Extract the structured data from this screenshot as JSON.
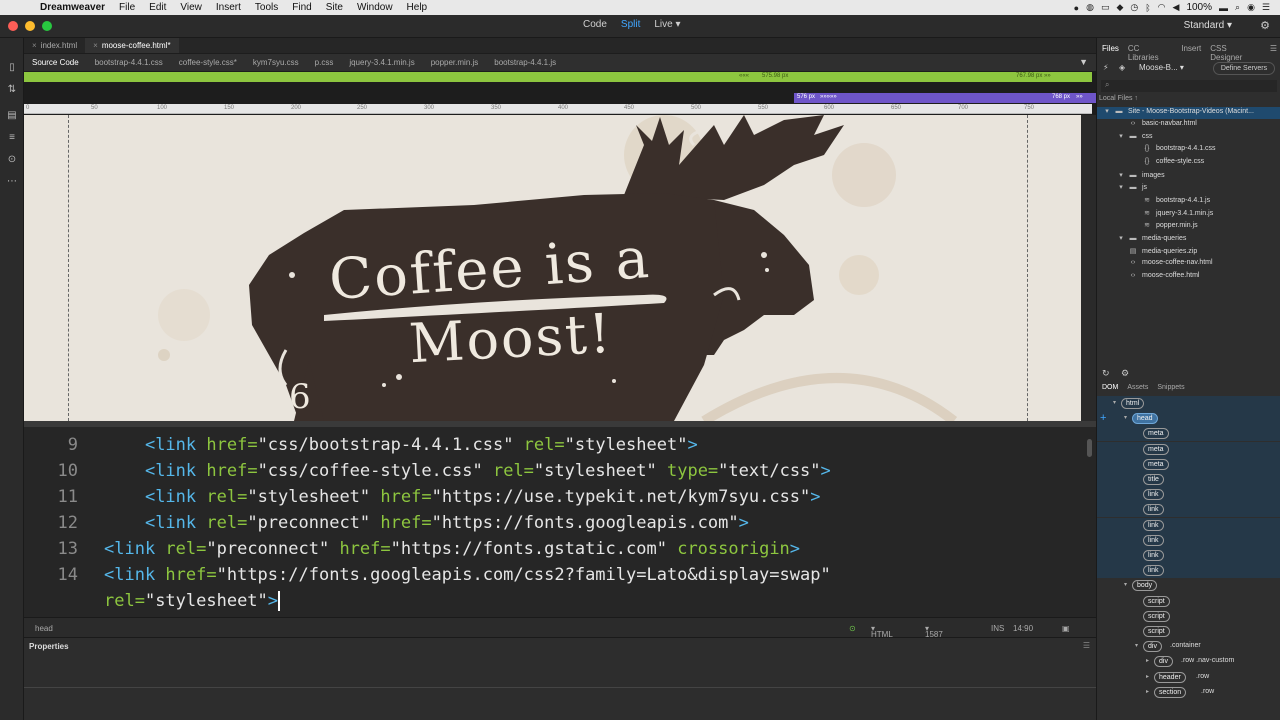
{
  "menubar": {
    "app_name": "Dreamweaver",
    "items": [
      "File",
      "Edit",
      "View",
      "Insert",
      "Tools",
      "Find",
      "Site",
      "Window",
      "Help"
    ],
    "battery": "100%",
    "apple_icon": "apple-icon"
  },
  "titlebar": {
    "views": [
      "Code",
      "Split",
      "Live"
    ],
    "active_view": "Split",
    "workspace": "Standard"
  },
  "doc_tabs": [
    {
      "label": "index.html",
      "active": false
    },
    {
      "label": "moose-coffee.html*",
      "active": true
    }
  ],
  "related_files": [
    "Source Code",
    "bootstrap-4.4.1.css",
    "coffee-style.css*",
    "kym7syu.css",
    "p.css",
    "jquery-3.4.1.min.js",
    "popper.min.js",
    "bootstrap-4.4.1.js"
  ],
  "media_queries": {
    "green_left": "575.98 px",
    "green_right": "767.98 px",
    "purple_left": "576 px",
    "purple_right": "768 px"
  },
  "ruler_ticks": [
    "0",
    "50",
    "100",
    "150",
    "200",
    "250",
    "300",
    "350",
    "400",
    "450",
    "500",
    "550",
    "600",
    "650",
    "700",
    "750"
  ],
  "live_view": {
    "headline_line1": "Coffee is a",
    "headline_line2": "Moost!"
  },
  "code_lines": [
    {
      "num": "9",
      "indent": "    ",
      "parts": [
        [
          "tag",
          "<link "
        ],
        [
          "attr",
          "href="
        ],
        [
          "val",
          "\"css/bootstrap-4.4.1.css\" "
        ],
        [
          "attr",
          "rel="
        ],
        [
          "val",
          "\"stylesheet\""
        ],
        [
          "tag",
          ">"
        ]
      ]
    },
    {
      "num": "10",
      "indent": "    ",
      "parts": [
        [
          "tag",
          "<link "
        ],
        [
          "attr",
          "href="
        ],
        [
          "val",
          "\"css/coffee-style.css\" "
        ],
        [
          "attr",
          "rel="
        ],
        [
          "val",
          "\"stylesheet\" "
        ],
        [
          "attr",
          "type="
        ],
        [
          "val",
          "\"text/css\""
        ],
        [
          "tag",
          ">"
        ]
      ]
    },
    {
      "num": "11",
      "indent": "    ",
      "parts": [
        [
          "tag",
          "<link "
        ],
        [
          "attr",
          "rel="
        ],
        [
          "val",
          "\"stylesheet\" "
        ],
        [
          "attr",
          "href="
        ],
        [
          "val",
          "\"https://use.typekit.net/kym7syu.css\""
        ],
        [
          "tag",
          ">"
        ]
      ]
    },
    {
      "num": "12",
      "indent": "    ",
      "parts": [
        [
          "tag",
          "<link "
        ],
        [
          "attr",
          "rel="
        ],
        [
          "val",
          "\"preconnect\" "
        ],
        [
          "attr",
          "href="
        ],
        [
          "val",
          "\"https://fonts.googleapis.com\""
        ],
        [
          "tag",
          ">"
        ]
      ]
    },
    {
      "num": "13",
      "indent": "",
      "parts": [
        [
          "tag",
          "<link "
        ],
        [
          "attr",
          "rel="
        ],
        [
          "val",
          "\"preconnect\" "
        ],
        [
          "attr",
          "href="
        ],
        [
          "val",
          "\"https://fonts.gstatic.com\" "
        ],
        [
          "attr",
          "crossorigin"
        ],
        [
          "tag",
          ">"
        ]
      ]
    },
    {
      "num": "14",
      "indent": "",
      "parts": [
        [
          "tag",
          "<link "
        ],
        [
          "attr",
          "href="
        ],
        [
          "val",
          "\"https://fonts.googleapis.com/css2?family=Lato&display=swap\""
        ]
      ]
    },
    {
      "num": "",
      "indent": "",
      "parts": [
        [
          "attr",
          "rel="
        ],
        [
          "val",
          "\"stylesheet\""
        ],
        [
          "tag",
          ">"
        ]
      ]
    }
  ],
  "statusbar": {
    "tag": "head",
    "language": "HTML",
    "dimensions": "1587 x 457",
    "mode": "INS",
    "position": "14:90"
  },
  "properties": {
    "title": "Properties"
  },
  "files_panel": {
    "tabs": [
      "Files",
      "CC Libraries",
      "Insert",
      "CSS Designer"
    ],
    "active_tab": "Files",
    "site_select": "Moose-B...",
    "define_servers": "Define Servers",
    "local_files": "Local Files",
    "tree": [
      {
        "label": "Site - Moose-Bootstrap-Videos (Macint...",
        "depth": 0,
        "icon": "folder-icon",
        "selected": true
      },
      {
        "label": "basic-navbar.html",
        "depth": 1,
        "icon": "html-file-icon"
      },
      {
        "label": "css",
        "depth": 1,
        "icon": "folder-icon"
      },
      {
        "label": "bootstrap-4.4.1.css",
        "depth": 2,
        "icon": "css-file-icon"
      },
      {
        "label": "coffee-style.css",
        "depth": 2,
        "icon": "css-file-icon"
      },
      {
        "label": "images",
        "depth": 1,
        "icon": "folder-icon"
      },
      {
        "label": "js",
        "depth": 1,
        "icon": "folder-icon"
      },
      {
        "label": "bootstrap-4.4.1.js",
        "depth": 2,
        "icon": "js-file-icon"
      },
      {
        "label": "jquery-3.4.1.min.js",
        "depth": 2,
        "icon": "js-file-icon"
      },
      {
        "label": "popper.min.js",
        "depth": 2,
        "icon": "js-file-icon"
      },
      {
        "label": "media-queries",
        "depth": 1,
        "icon": "folder-icon"
      },
      {
        "label": "media-queries.zip",
        "depth": 1,
        "icon": "zip-file-icon"
      },
      {
        "label": "moose-coffee-nav.html",
        "depth": 1,
        "icon": "html-file-icon"
      },
      {
        "label": "moose-coffee.html",
        "depth": 1,
        "icon": "html-file-icon"
      }
    ]
  },
  "dom_panel": {
    "tabs": [
      "DOM",
      "Assets",
      "Snippets"
    ],
    "active_tab": "DOM",
    "nodes": [
      {
        "tag": "html",
        "cls": "",
        "depth": 0
      },
      {
        "tag": "head",
        "cls": "",
        "depth": 1,
        "selected": true
      },
      {
        "tag": "meta",
        "cls": "",
        "depth": 2
      },
      {
        "tag": "meta",
        "cls": "",
        "depth": 2
      },
      {
        "tag": "meta",
        "cls": "",
        "depth": 2
      },
      {
        "tag": "title",
        "cls": "",
        "depth": 2
      },
      {
        "tag": "link",
        "cls": "",
        "depth": 2
      },
      {
        "tag": "link",
        "cls": "",
        "depth": 2
      },
      {
        "tag": "link",
        "cls": "",
        "depth": 2
      },
      {
        "tag": "link",
        "cls": "",
        "depth": 2
      },
      {
        "tag": "link",
        "cls": "",
        "depth": 2
      },
      {
        "tag": "link",
        "cls": "",
        "depth": 2
      },
      {
        "tag": "body",
        "cls": "",
        "depth": 1
      },
      {
        "tag": "script",
        "cls": "",
        "depth": 2
      },
      {
        "tag": "script",
        "cls": "",
        "depth": 2
      },
      {
        "tag": "script",
        "cls": "",
        "depth": 2
      },
      {
        "tag": "div",
        "cls": ".container",
        "depth": 2
      },
      {
        "tag": "div",
        "cls": ".row .nav-custom",
        "depth": 3
      },
      {
        "tag": "header",
        "cls": ".row",
        "depth": 3
      },
      {
        "tag": "section",
        "cls": ".row",
        "depth": 3
      }
    ]
  },
  "colors": {
    "accent_blue": "#40a6ff",
    "media_green": "#8dc63f",
    "media_purple": "#6e55c9",
    "moose_brown": "#3a2f2a"
  }
}
